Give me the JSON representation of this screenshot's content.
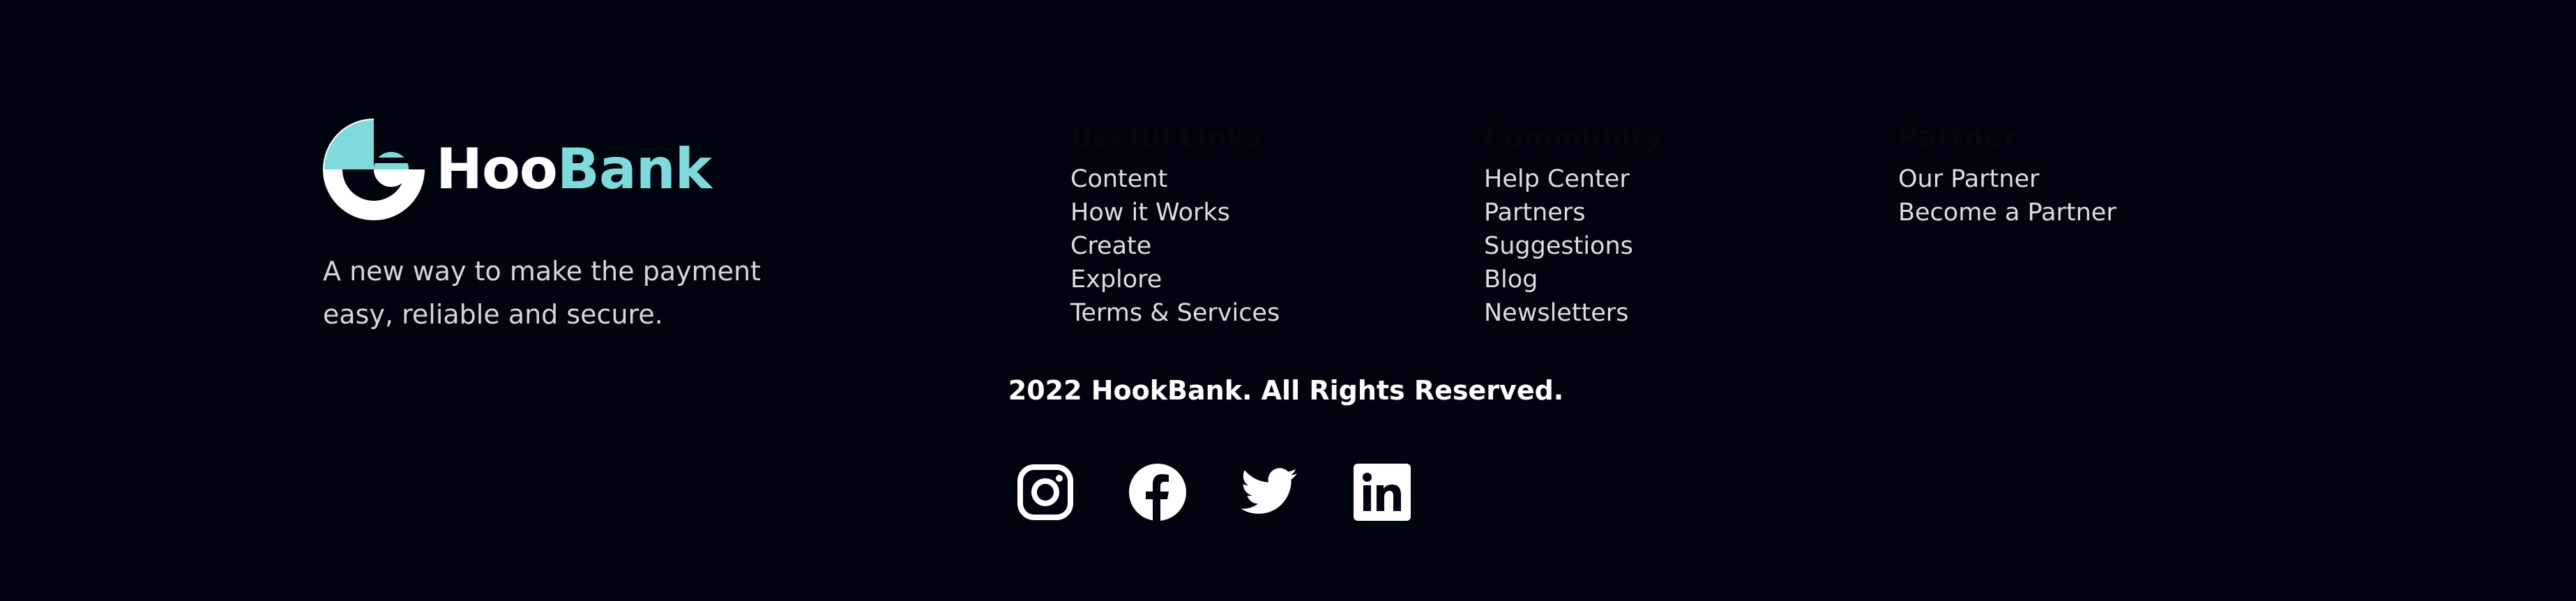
{
  "brand": {
    "name_part1": "Hoo",
    "name_part2": "Bank",
    "tagline": "A new way to make the payment easy, reliable and secure.",
    "accent_color": "#7fdbdb",
    "logo_icon": "hoobank-logo-icon"
  },
  "columns": [
    {
      "title": "Useful Links",
      "links": [
        "Content",
        "How it Works",
        "Create",
        "Explore",
        "Terms & Services"
      ]
    },
    {
      "title": "Community",
      "links": [
        "Help Center",
        "Partners",
        "Suggestions",
        "Blog",
        "Newsletters"
      ]
    },
    {
      "title": "Partner",
      "links": [
        "Our Partner",
        "Become a Partner"
      ]
    }
  ],
  "copyright": "2022 HookBank. All Rights Reserved.",
  "socials": [
    {
      "name": "instagram",
      "icon": "instagram-icon"
    },
    {
      "name": "facebook",
      "icon": "facebook-icon"
    },
    {
      "name": "twitter",
      "icon": "twitter-icon"
    },
    {
      "name": "linkedin",
      "icon": "linkedin-icon"
    }
  ],
  "colors": {
    "background": "#00040f",
    "text": "#ffffff",
    "muted_text": "#dcdde0"
  }
}
